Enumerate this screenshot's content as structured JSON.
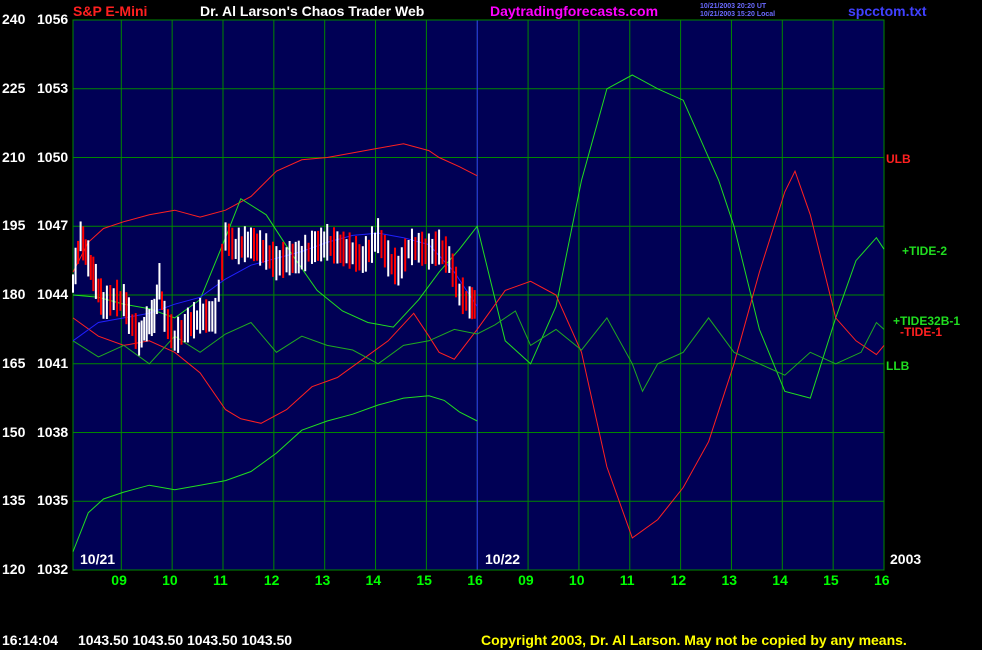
{
  "header": {
    "title_left": "S&P E-Mini",
    "title_center": "Dr. Al Larson's Chaos Trader Web",
    "site": "Daytradingforecasts.com",
    "time_ut": "10/21/2003 20:20 UT",
    "time_local": "10/21/2003 15:20 Local",
    "file": "spcctom.txt"
  },
  "colors": {
    "background": "#000000",
    "plot_bg": "#000055",
    "grid": "#008800",
    "title_left": "#ff2020",
    "title_center": "#ffffff",
    "site": "#ff00ff",
    "file": "#4040ff",
    "price_up": "#ffffff",
    "price_down": "#ff0000",
    "ulb": "#ff2020",
    "llb": "#20dd20",
    "tide2": "#20dd20",
    "tide1": "#ff2020",
    "tide32b": "#20aa20",
    "ma": "#2020ff"
  },
  "footer": {
    "time": "16:14:04",
    "quote": "1043.50 1043.50 1043.50 1043.50",
    "copyright": "Copyright 2003, Dr. Al Larson. May not be copied by any means."
  },
  "chart_data": {
    "type": "line",
    "title": "S&P E-Mini",
    "y_left_ticks": [
      "240",
      "225",
      "210",
      "195",
      "180",
      "165",
      "150",
      "135",
      "120"
    ],
    "y_right_ticks": [
      "1056",
      "1053",
      "1050",
      "1047",
      "1044",
      "1041",
      "1038",
      "1035",
      "1032"
    ],
    "ylim_price": [
      1032,
      1056
    ],
    "ylim_index": [
      120,
      240
    ],
    "x_ticks": [
      "09",
      "10",
      "11",
      "12",
      "13",
      "14",
      "15",
      "16",
      "09",
      "10",
      "11",
      "12",
      "13",
      "14",
      "15",
      "16"
    ],
    "date_markers": [
      "10/21",
      "10/22"
    ],
    "year_label": "2003",
    "grid": true,
    "series_labels": [
      "ULB",
      "+TIDE-2",
      "+TIDE32B-1",
      "-TIDE-1",
      "LLB"
    ],
    "series": [
      {
        "name": "ULB",
        "color_key": "ulb",
        "x": [
          0,
          0.3,
          0.6,
          1.0,
          1.5,
          2.0,
          2.5,
          3.0,
          3.5,
          4.0,
          4.5,
          5.0,
          5.5,
          6.0,
          6.5,
          7.0,
          7.2,
          7.6,
          7.95
        ],
        "y": [
          1045.0,
          1046.3,
          1046.9,
          1047.2,
          1047.5,
          1047.7,
          1047.4,
          1047.7,
          1048.3,
          1049.4,
          1049.9,
          1050.0,
          1050.2,
          1050.4,
          1050.6,
          1050.3,
          1050.0,
          1049.6,
          1049.2
        ]
      },
      {
        "name": "LLB",
        "color_key": "llb",
        "x": [
          0,
          0.3,
          0.6,
          1.0,
          1.5,
          2.0,
          2.5,
          3.0,
          3.5,
          4.0,
          4.5,
          5.0,
          5.5,
          6.0,
          6.5,
          7.0,
          7.3,
          7.6,
          7.95
        ],
        "y": [
          1032.8,
          1034.5,
          1035.1,
          1035.4,
          1035.7,
          1035.5,
          1035.7,
          1035.9,
          1036.3,
          1037.1,
          1038.1,
          1038.5,
          1038.8,
          1039.2,
          1039.5,
          1039.6,
          1039.4,
          1038.9,
          1038.5
        ]
      },
      {
        "name": "+TIDE-2",
        "color_key": "tide2",
        "x": [
          0,
          0.5,
          1.0,
          1.5,
          2.0,
          2.5,
          3.0,
          3.3,
          3.8,
          4.3,
          4.8,
          5.3,
          5.8,
          6.3,
          6.8,
          7.2,
          7.6,
          7.95,
          8.5,
          9.0,
          9.5,
          10.0,
          10.5,
          11.0,
          11.5,
          12.0,
          12.3,
          12.7,
          13.0,
          13.5,
          14.0,
          14.5,
          15.0,
          15.4,
          15.8,
          15.95
        ],
        "y": [
          1044.0,
          1043.9,
          1043.6,
          1043.4,
          1043.0,
          1043.8,
          1046.5,
          1048.2,
          1047.5,
          1045.8,
          1044.2,
          1043.3,
          1042.8,
          1042.6,
          1043.8,
          1045.0,
          1046.0,
          1047.0,
          1042.0,
          1041.0,
          1043.5,
          1049.0,
          1053.0,
          1053.6,
          1053.0,
          1052.5,
          1051.0,
          1049.0,
          1047.0,
          1042.5,
          1039.8,
          1039.5,
          1043.0,
          1045.5,
          1046.5,
          1046.0
        ]
      },
      {
        "name": "-TIDE-1",
        "color_key": "tide1",
        "x": [
          0,
          0.5,
          1.0,
          1.5,
          2.0,
          2.5,
          3.0,
          3.3,
          3.7,
          4.2,
          4.7,
          5.2,
          5.7,
          6.2,
          6.7,
          7.0,
          7.2,
          7.5,
          7.95,
          8.5,
          9.0,
          9.5,
          10.0,
          10.5,
          11.0,
          11.5,
          12.0,
          12.5,
          13.0,
          13.5,
          14.0,
          14.2,
          14.5,
          15.0,
          15.4,
          15.8,
          15.95
        ],
        "y": [
          1043.0,
          1042.2,
          1041.8,
          1042.0,
          1041.5,
          1040.6,
          1039.0,
          1038.6,
          1038.4,
          1039.0,
          1040.0,
          1040.4,
          1041.2,
          1042.0,
          1043.2,
          1042.2,
          1041.5,
          1041.2,
          1042.5,
          1044.2,
          1044.6,
          1044.0,
          1041.5,
          1036.5,
          1033.4,
          1034.2,
          1035.6,
          1037.6,
          1041.0,
          1045.0,
          1048.5,
          1049.4,
          1047.5,
          1043.0,
          1042.0,
          1041.4,
          1041.8
        ]
      },
      {
        "name": "+TIDE32B-1",
        "color_key": "tide32b",
        "x": [
          0,
          0.5,
          1.0,
          1.5,
          2.0,
          2.5,
          3.0,
          3.5,
          4.0,
          4.5,
          5.0,
          5.5,
          6.0,
          6.5,
          7.0,
          7.5,
          7.95,
          8.3,
          8.7,
          9.0,
          9.5,
          10.0,
          10.5,
          11.0,
          11.2,
          11.5,
          12.0,
          12.5,
          13.0,
          13.5,
          14.0,
          14.5,
          15.0,
          15.5,
          15.8,
          15.95
        ],
        "y": [
          1042.0,
          1041.3,
          1041.8,
          1041.0,
          1042.2,
          1041.5,
          1042.3,
          1042.8,
          1041.5,
          1042.2,
          1041.8,
          1041.6,
          1041.0,
          1041.8,
          1042.0,
          1042.5,
          1042.3,
          1042.7,
          1043.3,
          1041.8,
          1042.5,
          1041.6,
          1043.0,
          1041.0,
          1039.8,
          1041.0,
          1041.5,
          1043.0,
          1041.5,
          1041.0,
          1040.5,
          1041.5,
          1041.0,
          1041.5,
          1042.8,
          1042.5
        ]
      },
      {
        "name": "",
        "color_key": "ma",
        "x": [
          0,
          0.5,
          1.0,
          1.5,
          2.0,
          2.5,
          3.0,
          3.5,
          4.0,
          4.5,
          5.0,
          5.5,
          6.0,
          6.5,
          7.0,
          7.5,
          7.95
        ],
        "y": [
          1042.0,
          1042.8,
          1043.0,
          1043.2,
          1043.6,
          1043.9,
          1044.7,
          1045.3,
          1045.6,
          1045.9,
          1046.3,
          1046.6,
          1046.7,
          1046.5,
          1046.2,
          1045.0,
          1043.5
        ]
      },
      {
        "name": "",
        "color_key": "price_up",
        "x": [
          0.0,
          0.15,
          0.3,
          0.45,
          0.6,
          0.8,
          1.0,
          1.1,
          1.3,
          1.4,
          1.5,
          1.6,
          1.7,
          1.8,
          2.0,
          2.2,
          2.5,
          2.8,
          3.0,
          3.2,
          3.5,
          3.8,
          4.0,
          4.2,
          4.5,
          4.7,
          5.0,
          5.2,
          5.5,
          5.7,
          6.0,
          6.2,
          6.4,
          6.6,
          6.8,
          7.0,
          7.2,
          7.4,
          7.6,
          7.8,
          7.95
        ],
        "y": [
          1044.5,
          1046.5,
          1045.5,
          1044.5,
          1043.5,
          1043.8,
          1043.7,
          1043.0,
          1042.0,
          1042.5,
          1042.8,
          1043.0,
          1044.5,
          1043.0,
          1042.0,
          1042.5,
          1043.0,
          1043.0,
          1046.5,
          1046.0,
          1046.2,
          1045.8,
          1045.3,
          1045.5,
          1045.6,
          1046.0,
          1046.2,
          1046.0,
          1045.8,
          1045.5,
          1046.5,
          1045.5,
          1045.0,
          1046.0,
          1046.0,
          1045.8,
          1046.0,
          1045.5,
          1044.0,
          1043.6,
          1043.5
        ]
      }
    ]
  }
}
